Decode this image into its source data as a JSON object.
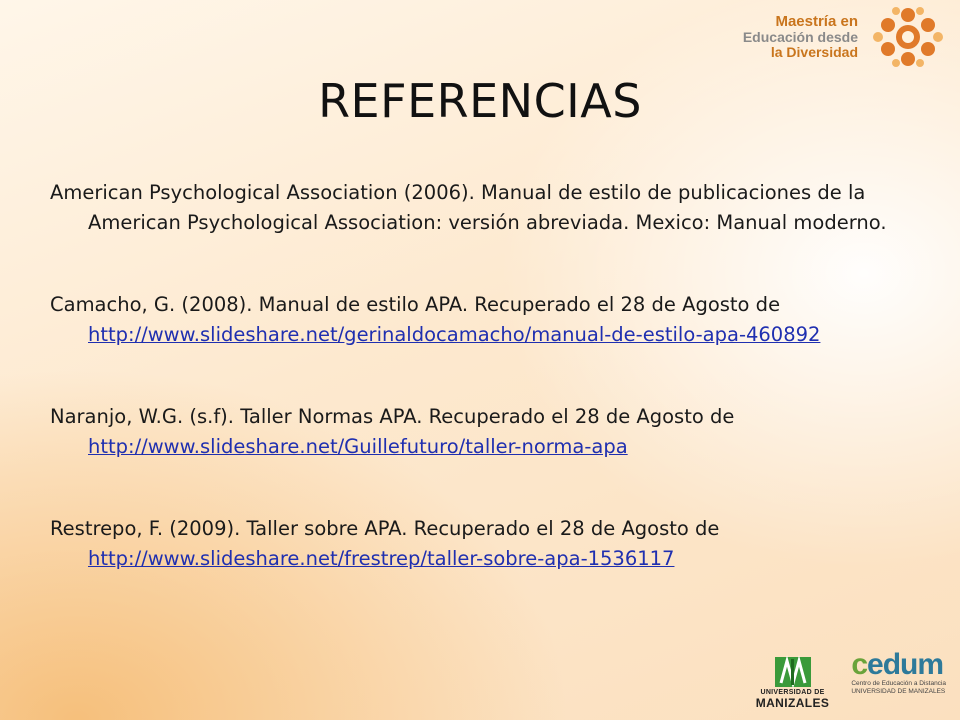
{
  "title": "REFERENCIAS",
  "brand": {
    "line1": "Maestría en",
    "line2": "Educación desde",
    "line3": "la Diversidad"
  },
  "references": [
    {
      "text": "American Psychological Association (2006). Manual de estilo de publicaciones de la American Psychological Association: versión abreviada. Mexico: Manual moderno.",
      "link": ""
    },
    {
      "text": "Camacho, G. (2008). Manual de estilo APA. Recuperado el 28 de Agosto de ",
      "link": "http://www.slideshare.net/gerinaldocamacho/manual-de-estilo-apa-460892"
    },
    {
      "text": "Naranjo, W.G. (s.f). Taller Normas APA. Recuperado el 28 de Agosto de ",
      "link": "http://www.slideshare.net/Guillefuturo/taller-norma-apa"
    },
    {
      "text": "Restrepo, F. (2009). Taller sobre APA. Recuperado el 28 de Agosto de ",
      "link": "http://www.slideshare.net/frestrep/taller-sobre-apa-1536117"
    }
  ],
  "footer": {
    "university_line1": "UNIVERSIDAD DE",
    "university_line2": "MANIZALES",
    "cedum_prefix": "c",
    "cedum_word": "edum",
    "cedum_sub1": "Centro de Educación a Distancia",
    "cedum_sub2": "UNIVERSIDAD DE MANIZALES"
  },
  "colors": {
    "accent": "#c9751d",
    "link": "#1f2fb0",
    "cedum_blue": "#2e7a9a",
    "cedum_green": "#6aa33a"
  }
}
